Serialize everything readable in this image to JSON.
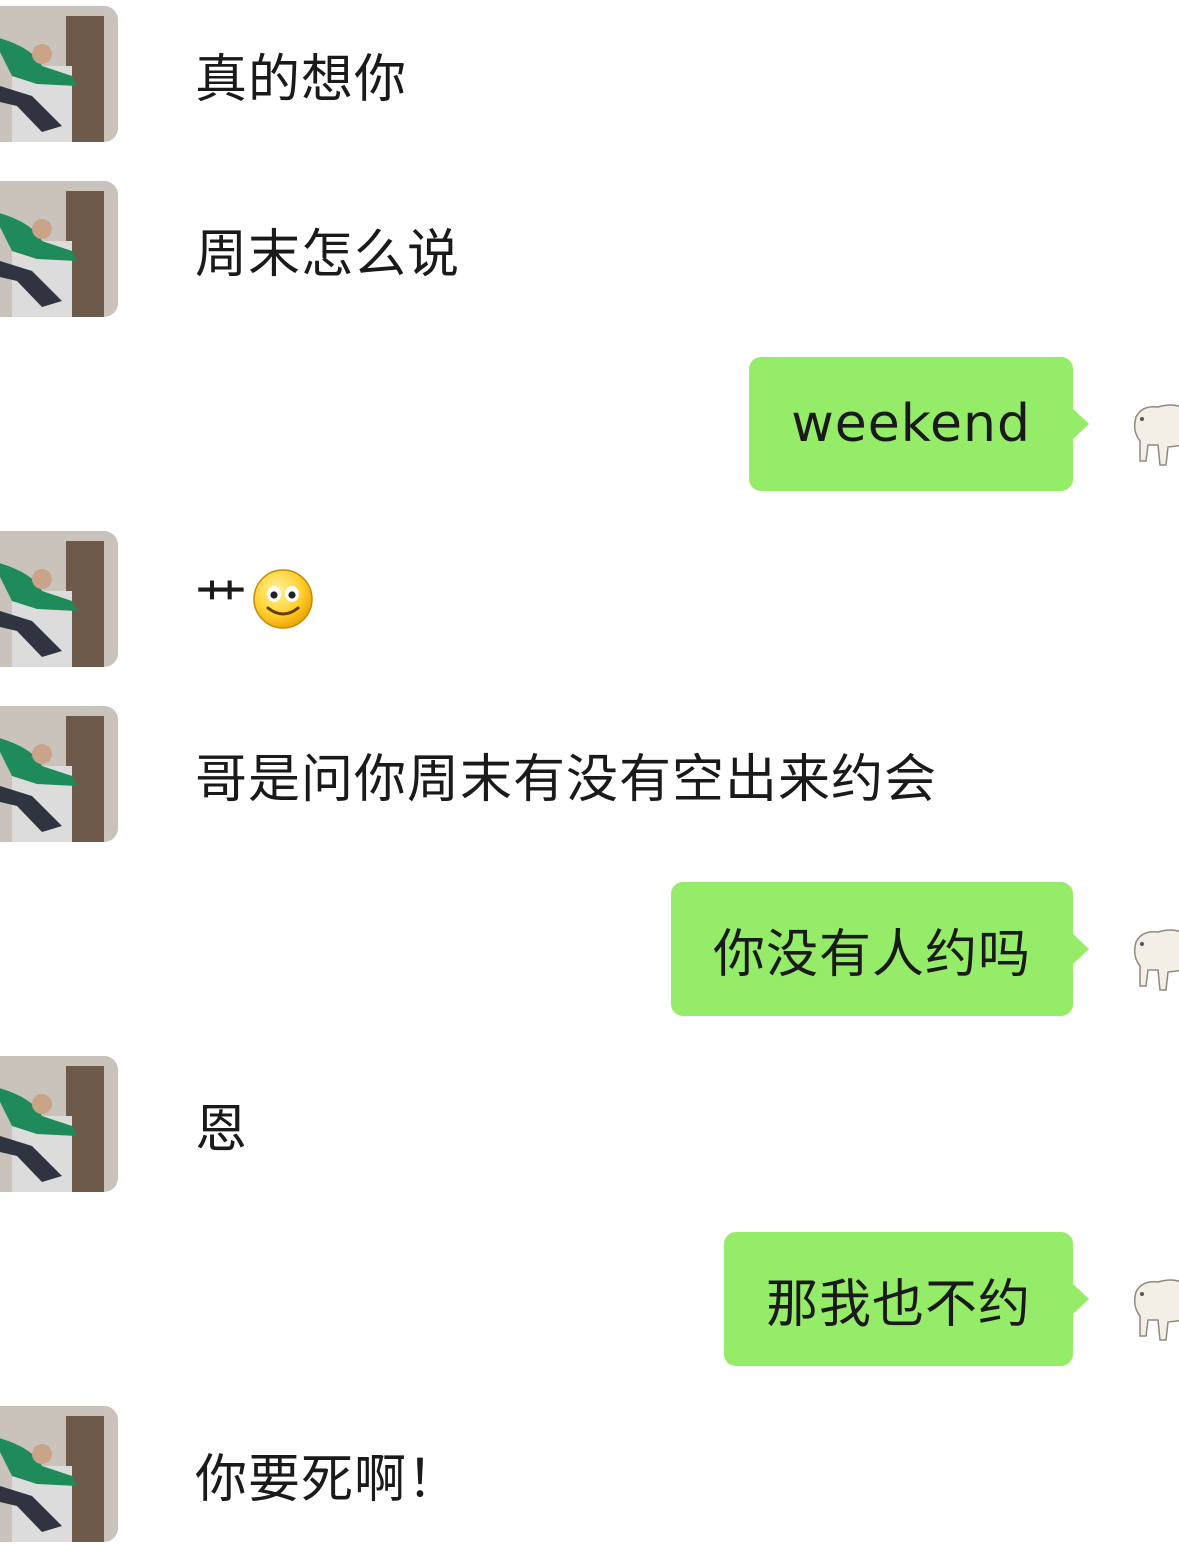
{
  "messages": [
    {
      "side": "in",
      "text": "真的想你"
    },
    {
      "side": "in",
      "text": "周末怎么说"
    },
    {
      "side": "out",
      "text": "weekend"
    },
    {
      "side": "in",
      "text": "艹",
      "emoji": "smile-emoji"
    },
    {
      "side": "in",
      "text": "哥是问你周末有没有空出来约会"
    },
    {
      "side": "out",
      "text": "你没有人约吗"
    },
    {
      "side": "in",
      "text": "恩"
    },
    {
      "side": "out",
      "text": "那我也不约"
    },
    {
      "side": "in",
      "text": "你要死啊！"
    }
  ],
  "colors": {
    "outgoing_bubble": "#95ec69",
    "background": "#ffffff",
    "text": "#1a1a1a"
  },
  "icons": {
    "incoming_avatar": "contact-avatar-photo",
    "outgoing_avatar": "sheep-avatar-drawing",
    "emoji": "smile-emoji"
  }
}
